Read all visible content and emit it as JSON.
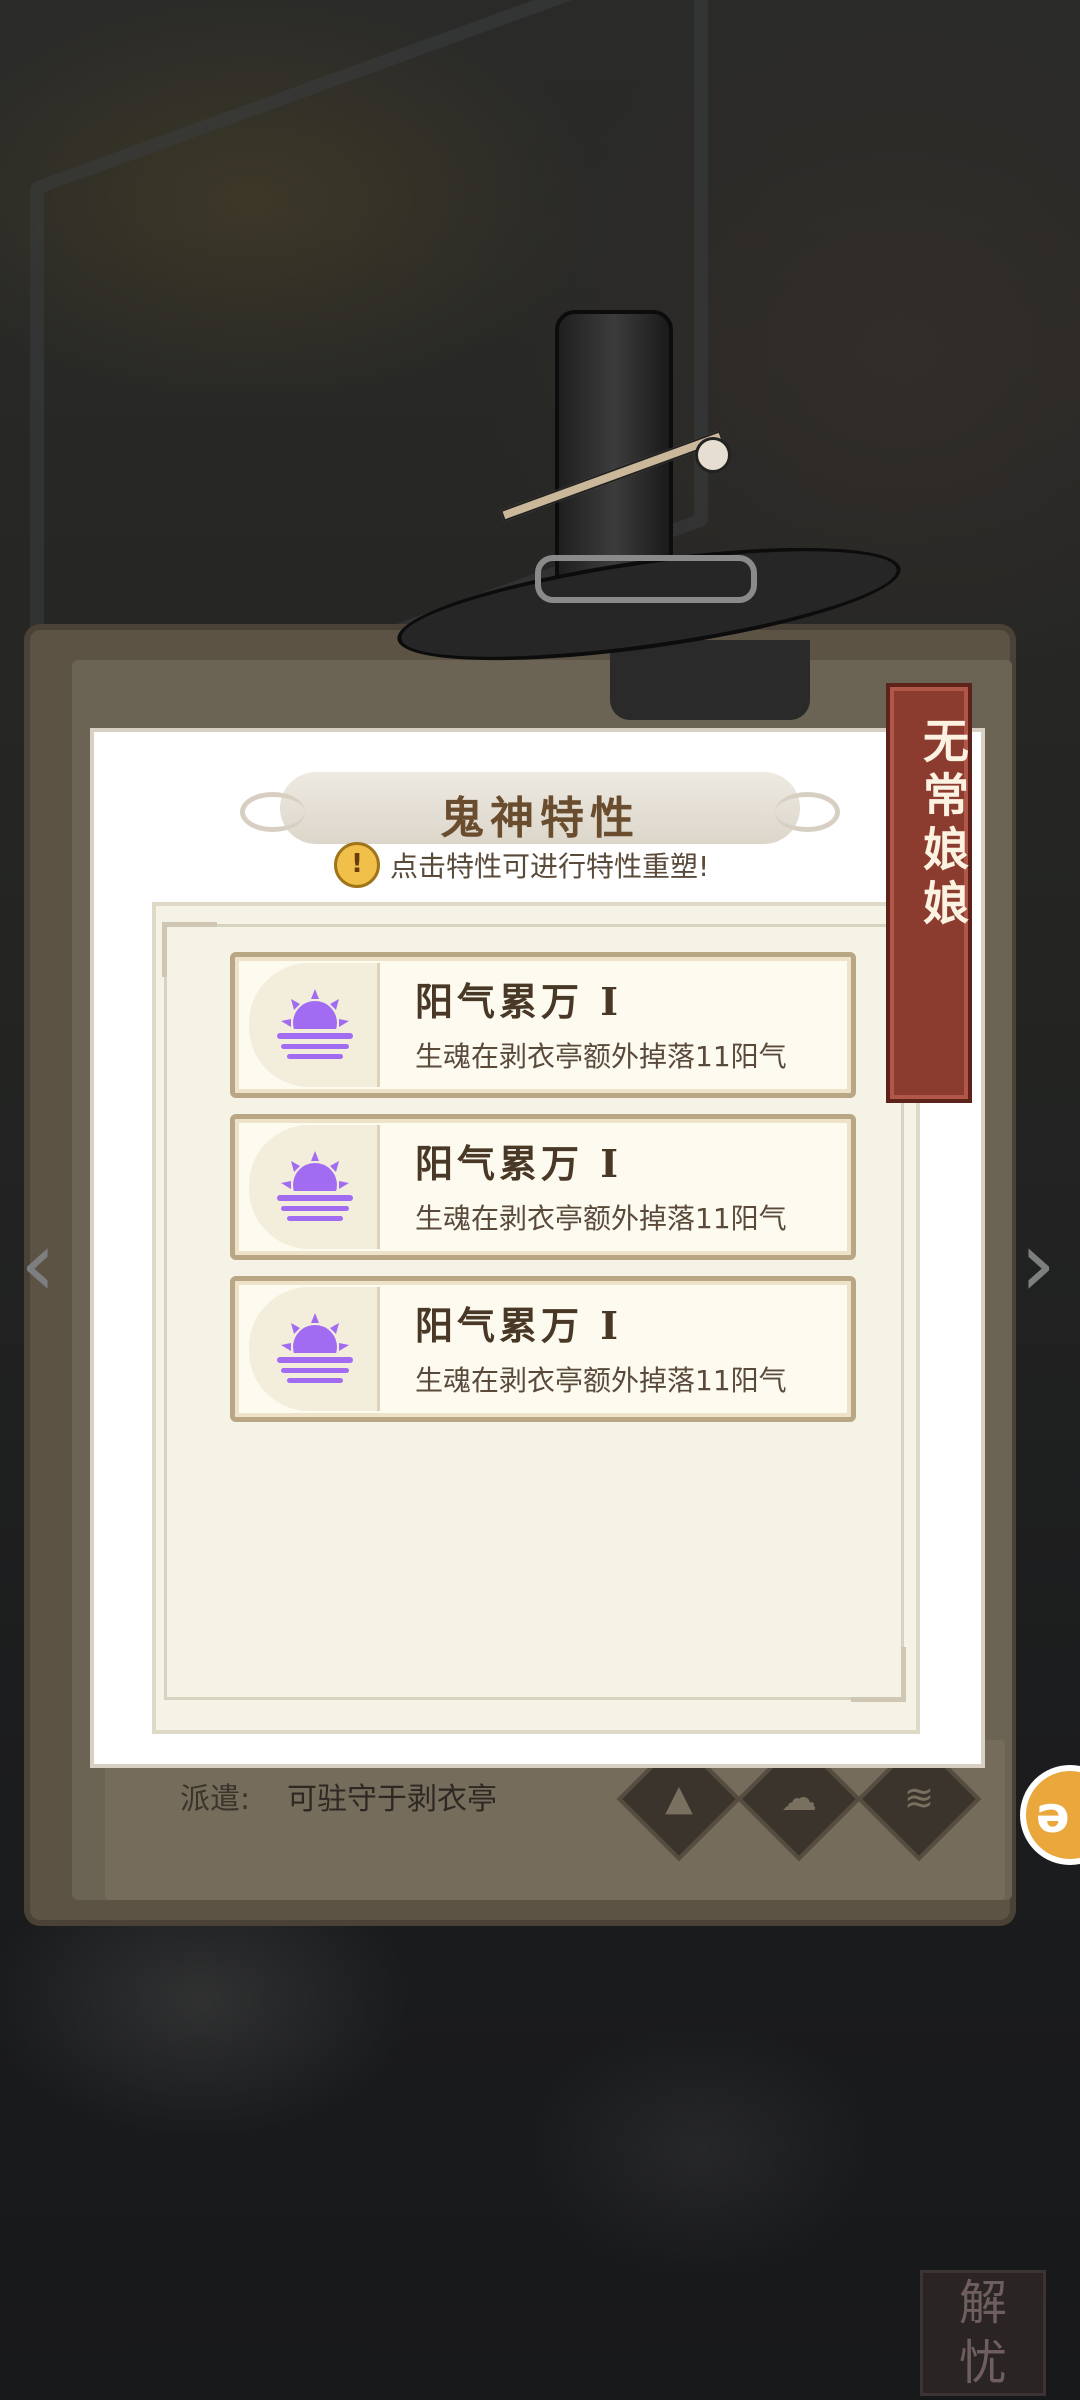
{
  "dialog": {
    "title": "鬼神特性",
    "hint": "点击特性可进行特性重塑!",
    "traits": [
      {
        "name": "阳气累万 I",
        "desc": "生魂在剥衣亭额外掉落11阳气",
        "icon": "purple-sunset-icon"
      },
      {
        "name": "阳气累万 I",
        "desc": "生魂在剥衣亭额外掉落11阳气",
        "icon": "purple-sunset-icon"
      },
      {
        "name": "阳气累万 I",
        "desc": "生魂在剥衣亭额外掉落11阳气",
        "icon": "purple-sunset-icon"
      }
    ]
  },
  "character": {
    "name": "无常娘娘"
  },
  "background_panel": {
    "dispatch_label": "派遣:",
    "dispatch_value": "可驻守于剥衣亭"
  },
  "colors": {
    "name_tag": "#8c3b2f",
    "trait_icon": "#a26cf2",
    "title_text": "#6a4c2e"
  }
}
